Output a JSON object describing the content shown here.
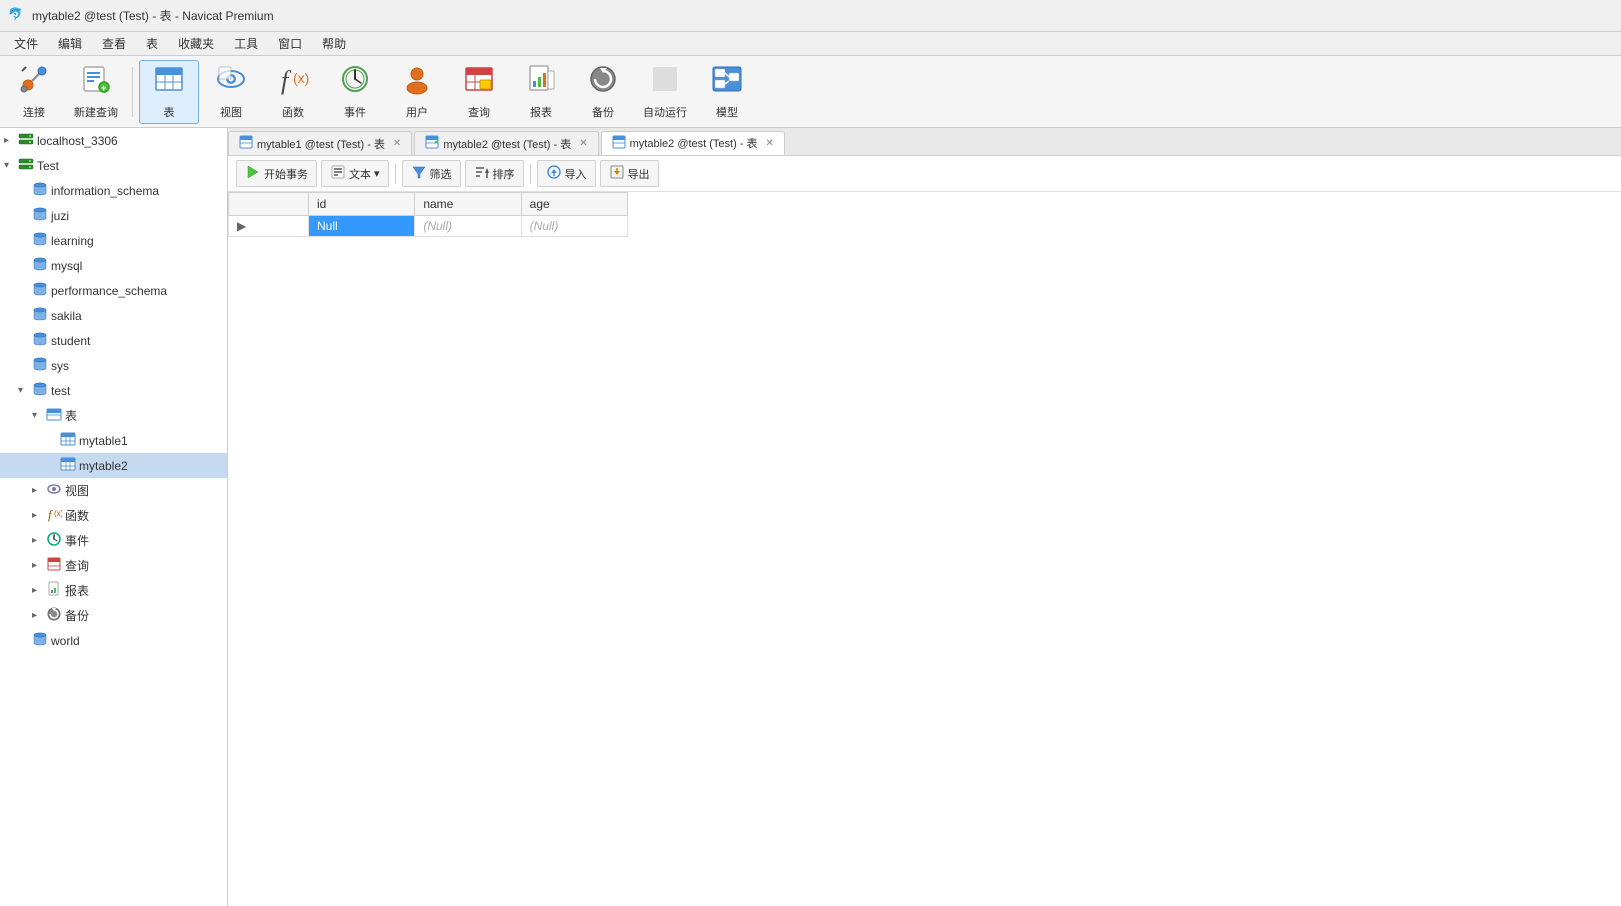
{
  "titleBar": {
    "title": "mytable2 @test (Test) - 表 - Navicat Premium",
    "appIcon": "🐬"
  },
  "menuBar": {
    "items": [
      "文件",
      "编辑",
      "查看",
      "表",
      "收藏夹",
      "工具",
      "窗口",
      "帮助"
    ]
  },
  "toolbar": {
    "buttons": [
      {
        "id": "connect",
        "icon": "🔌",
        "label": "连接",
        "active": false
      },
      {
        "id": "new-query",
        "icon": "📋",
        "label": "新建查询",
        "active": false
      },
      {
        "id": "table",
        "icon": "📊",
        "label": "表",
        "active": true
      },
      {
        "id": "view",
        "icon": "👁",
        "label": "视图",
        "active": false
      },
      {
        "id": "function",
        "icon": "ƒ(x)",
        "label": "函数",
        "active": false
      },
      {
        "id": "event",
        "icon": "⏰",
        "label": "事件",
        "active": false
      },
      {
        "id": "user",
        "icon": "👤",
        "label": "用户",
        "active": false
      },
      {
        "id": "query",
        "icon": "📅",
        "label": "查询",
        "active": false
      },
      {
        "id": "report",
        "icon": "📊",
        "label": "报表",
        "active": false
      },
      {
        "id": "backup",
        "icon": "🔄",
        "label": "备份",
        "active": false
      },
      {
        "id": "auto-run",
        "icon": "✅",
        "label": "自动运行",
        "active": false
      },
      {
        "id": "model",
        "icon": "🗂",
        "label": "模型",
        "active": false
      }
    ]
  },
  "sidebar": {
    "tree": [
      {
        "id": "localhost",
        "label": "localhost_3306",
        "level": 0,
        "hasArrow": true,
        "arrowOpen": false,
        "iconType": "server-green",
        "selected": false
      },
      {
        "id": "test-root",
        "label": "Test",
        "level": 0,
        "hasArrow": true,
        "arrowOpen": true,
        "iconType": "server-green",
        "selected": false
      },
      {
        "id": "information_schema",
        "label": "information_schema",
        "level": 1,
        "hasArrow": false,
        "iconType": "db",
        "selected": false
      },
      {
        "id": "juzi",
        "label": "juzi",
        "level": 1,
        "hasArrow": false,
        "iconType": "db",
        "selected": false
      },
      {
        "id": "learning",
        "label": "learning",
        "level": 1,
        "hasArrow": false,
        "iconType": "db",
        "selected": false
      },
      {
        "id": "mysql",
        "label": "mysql",
        "level": 1,
        "hasArrow": false,
        "iconType": "db",
        "selected": false
      },
      {
        "id": "performance_schema",
        "label": "performance_schema",
        "level": 1,
        "hasArrow": false,
        "iconType": "db",
        "selected": false
      },
      {
        "id": "sakila",
        "label": "sakila",
        "level": 1,
        "hasArrow": false,
        "iconType": "db",
        "selected": false
      },
      {
        "id": "student",
        "label": "student",
        "level": 1,
        "hasArrow": false,
        "iconType": "db",
        "selected": false
      },
      {
        "id": "sys",
        "label": "sys",
        "level": 1,
        "hasArrow": false,
        "iconType": "db",
        "selected": false
      },
      {
        "id": "test-db",
        "label": "test",
        "level": 1,
        "hasArrow": true,
        "arrowOpen": true,
        "iconType": "db",
        "selected": false
      },
      {
        "id": "tables-group",
        "label": "表",
        "level": 2,
        "hasArrow": true,
        "arrowOpen": true,
        "iconType": "table-folder",
        "selected": false
      },
      {
        "id": "mytable1",
        "label": "mytable1",
        "level": 3,
        "hasArrow": false,
        "iconType": "table",
        "selected": false
      },
      {
        "id": "mytable2",
        "label": "mytable2",
        "level": 3,
        "hasArrow": false,
        "iconType": "table",
        "selected": true
      },
      {
        "id": "views-group",
        "label": "视图",
        "level": 2,
        "hasArrow": true,
        "arrowOpen": false,
        "iconType": "view-folder",
        "selected": false
      },
      {
        "id": "functions-group",
        "label": "函数",
        "level": 2,
        "hasArrow": true,
        "arrowOpen": false,
        "iconType": "func-folder",
        "selected": false
      },
      {
        "id": "events-group",
        "label": "事件",
        "level": 2,
        "hasArrow": true,
        "arrowOpen": false,
        "iconType": "event-folder",
        "selected": false
      },
      {
        "id": "queries-group",
        "label": "查询",
        "level": 2,
        "hasArrow": true,
        "arrowOpen": false,
        "iconType": "query-folder",
        "selected": false
      },
      {
        "id": "reports-group",
        "label": "报表",
        "level": 2,
        "hasArrow": true,
        "arrowOpen": false,
        "iconType": "report-folder",
        "selected": false
      },
      {
        "id": "backups-group",
        "label": "备份",
        "level": 2,
        "hasArrow": true,
        "arrowOpen": false,
        "iconType": "backup-folder",
        "selected": false
      },
      {
        "id": "world",
        "label": "world",
        "level": 1,
        "hasArrow": false,
        "iconType": "db",
        "selected": false
      }
    ]
  },
  "tabs": [
    {
      "id": "tab1",
      "label": "mytable1 @test (Test) - 表",
      "active": false,
      "iconType": "table"
    },
    {
      "id": "tab2",
      "label": "mytable2 @test (Test) - 表",
      "active": false,
      "iconType": "table-edit"
    },
    {
      "id": "tab3",
      "label": "mytable2 @test (Test) - 表",
      "active": true,
      "iconType": "table"
    }
  ],
  "tableToolbar": {
    "buttons": [
      {
        "id": "begin-transaction",
        "icon": "▶",
        "label": "开始事务"
      },
      {
        "id": "text",
        "icon": "📄",
        "label": "文本",
        "hasArrow": true
      },
      {
        "id": "filter",
        "icon": "🔽",
        "label": "筛选"
      },
      {
        "id": "sort",
        "icon": "↕",
        "label": "排序"
      },
      {
        "id": "import",
        "icon": "📥",
        "label": "导入"
      },
      {
        "id": "export",
        "icon": "📤",
        "label": "导出"
      }
    ]
  },
  "dataTable": {
    "columns": [
      "id",
      "name",
      "age"
    ],
    "rows": [
      {
        "row_indicator": "▶",
        "id": "Null",
        "name": "(Null)",
        "age": "(Null)",
        "id_selected": true
      }
    ]
  },
  "colors": {
    "selected_cell": "#3399ff",
    "selected_row_bg": "#e8f0ff",
    "tab_active_bg": "#ffffff",
    "toolbar_active_bg": "#ddeeff"
  }
}
